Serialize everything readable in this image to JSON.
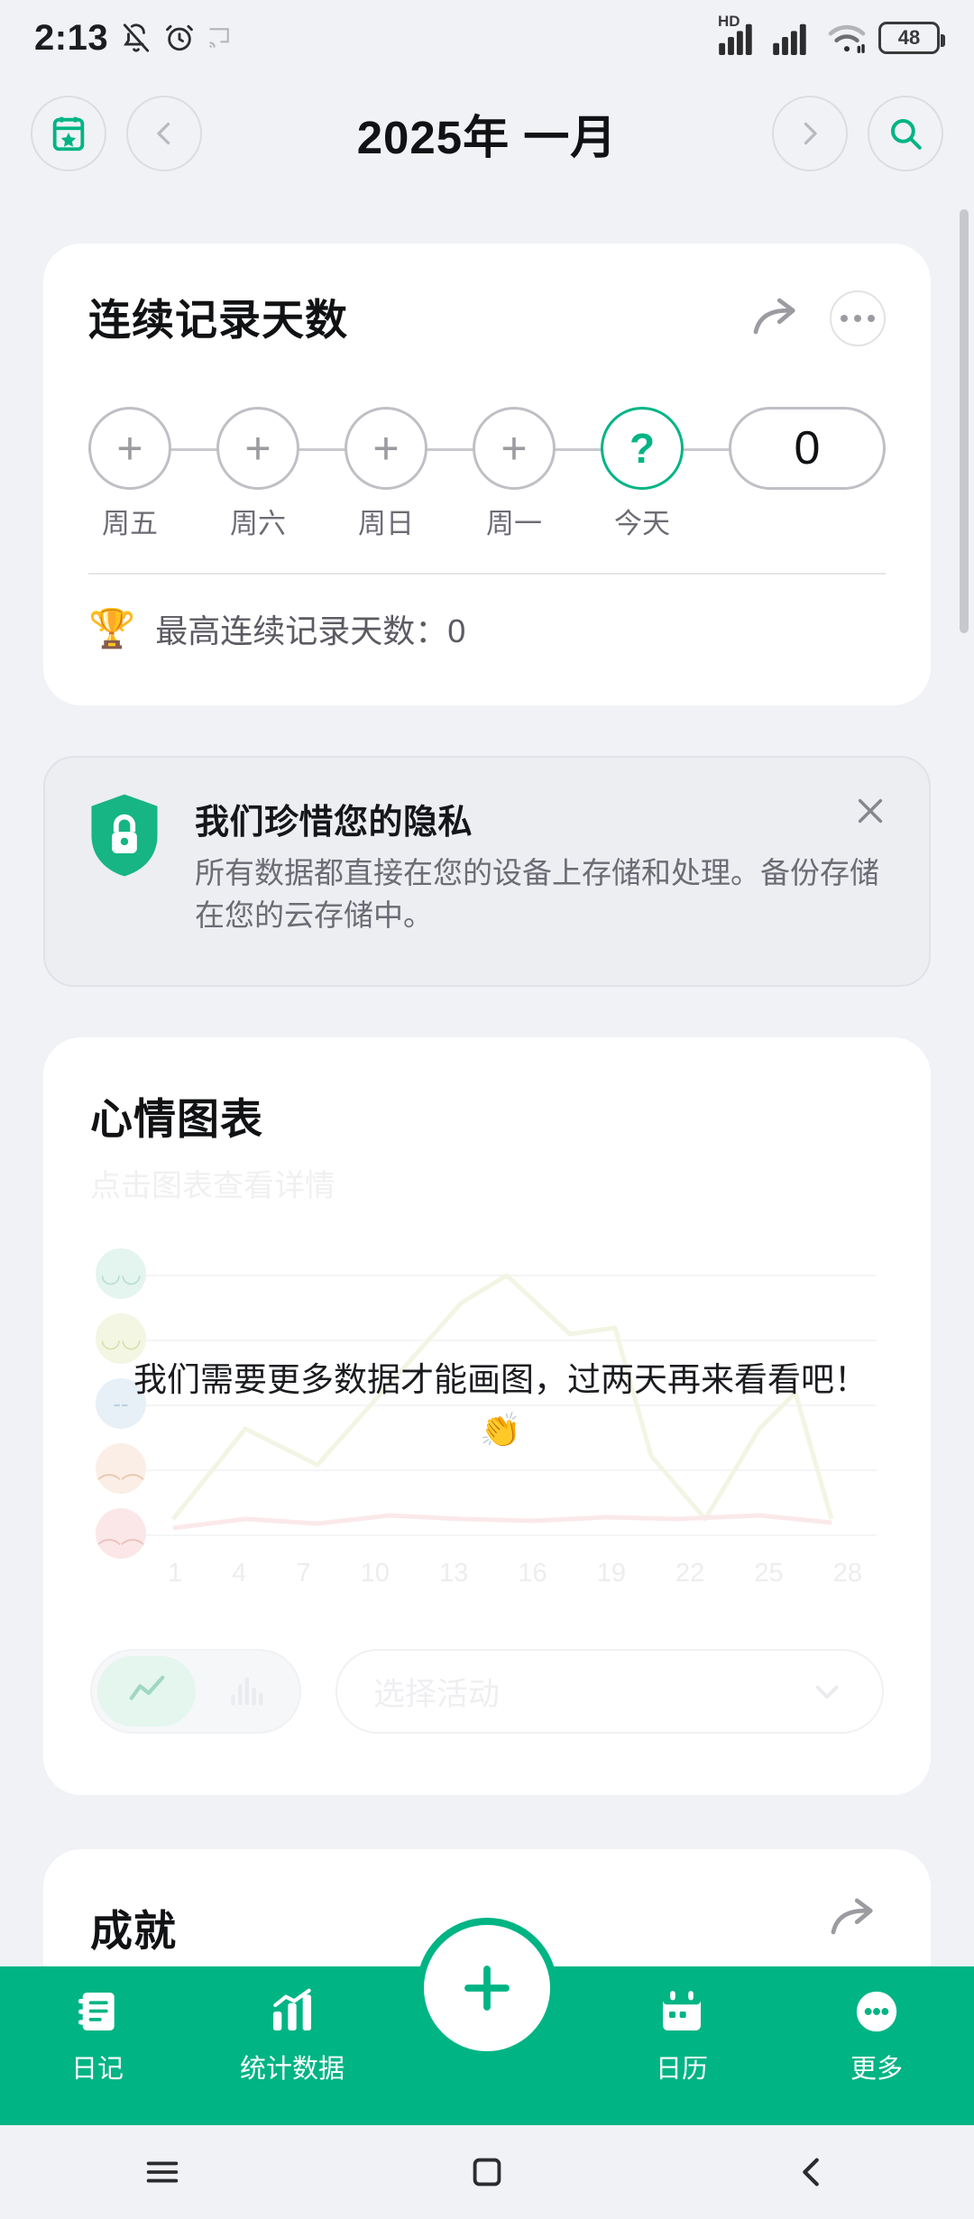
{
  "statusbar": {
    "time": "2:13",
    "icons": [
      "bell-off-icon",
      "alarm-icon",
      "cast-icon"
    ],
    "network_label": "HD",
    "battery_level": "48",
    "right_icons": [
      "signal-hd-icon",
      "signal-icon",
      "wifi-icon",
      "battery-icon"
    ]
  },
  "header": {
    "calendar_button": "calendar-star-icon",
    "prev_button": "chevron-left-icon",
    "title": "2025年 一月",
    "next_button": "chevron-right-icon",
    "search_button": "search-icon"
  },
  "streak": {
    "title": "连续记录天数",
    "share_icon": "share-arrow-icon",
    "more_icon": "more-horizontal-icon",
    "days": [
      {
        "label": "周五",
        "mark": "+",
        "state": "empty"
      },
      {
        "label": "周六",
        "mark": "+",
        "state": "empty"
      },
      {
        "label": "周日",
        "mark": "+",
        "state": "empty"
      },
      {
        "label": "周一",
        "mark": "+",
        "state": "empty"
      },
      {
        "label": "今天",
        "mark": "?",
        "state": "today"
      }
    ],
    "count": "0",
    "trophy_icon": "trophy-icon",
    "best_label": "最高连续记录天数：0"
  },
  "privacy": {
    "icon": "shield-lock-icon",
    "title": "我们珍惜您的隐私",
    "description": "所有数据都直接在您的设备上存储和处理。备份存储在您的云存储中。",
    "close_icon": "close-icon"
  },
  "mood": {
    "title": "心情图表",
    "subtitle": "点击图表查看详情",
    "empty_message": "我们需要更多数据才能画图，过两天再来看看吧！ 👏",
    "line_toggle_icon": "line-chart-icon",
    "bar_toggle_icon": "bar-chart-icon",
    "activity_placeholder": "选择活动",
    "dropdown_icon": "chevron-down-icon"
  },
  "achievements": {
    "title": "成就",
    "share_icon": "share-arrow-icon"
  },
  "bottomnav": {
    "items": [
      {
        "label": "日记",
        "icon": "notebook-icon"
      },
      {
        "label": "统计数据",
        "icon": "stats-icon"
      },
      {
        "label": "日历",
        "icon": "calendar-icon"
      },
      {
        "label": "更多",
        "icon": "more-dots-icon"
      }
    ],
    "fab_icon": "plus-icon"
  },
  "androidnav": {
    "items": [
      "recents-icon",
      "home-icon",
      "back-icon"
    ]
  },
  "colors": {
    "accent": "#00b484",
    "background": "#f1f2f6",
    "card": "#ffffff",
    "text": "#111214",
    "muted": "#6c6c74"
  },
  "chart_data": {
    "type": "line",
    "title": "心情图表",
    "subtitle": "点击图表查看详情",
    "x": [
      1,
      4,
      7,
      10,
      13,
      16,
      19,
      22,
      25,
      28
    ],
    "xtick_labels": [
      "1",
      "4",
      "7",
      "10",
      "13",
      "16",
      "19",
      "22",
      "25",
      "28"
    ],
    "ytick_labels": [
      "mood-great",
      "mood-good",
      "mood-neutral",
      "mood-bad",
      "mood-awful"
    ],
    "series": [
      {
        "name": "mood",
        "values": []
      }
    ],
    "xlabel": "",
    "ylabel": "",
    "grid": true,
    "legend": "none",
    "empty_state": "我们需要更多数据才能画图，过两天再来看看吧！ 👏"
  }
}
